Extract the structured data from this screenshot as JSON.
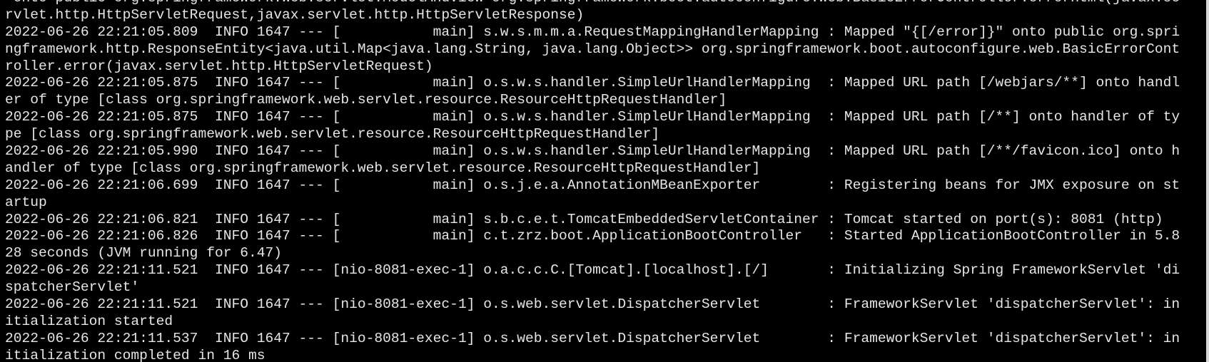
{
  "terminal": {
    "lines": [
      " onto public org.springframework.web.servlet.ModelAndView org.springframework.boot.autoconfigure.web.BasicErrorController.errorHtml(javax.se",
      "rvlet.http.HttpServletRequest,javax.servlet.http.HttpServletResponse)",
      "2022-06-26 22:21:05.809  INFO 1647 --- [           main] s.w.s.m.m.a.RequestMappingHandlerMapping : Mapped \"{[/error]}\" onto public org.spri",
      "ngframework.http.ResponseEntity<java.util.Map<java.lang.String, java.lang.Object>> org.springframework.boot.autoconfigure.web.BasicErrorCont",
      "roller.error(javax.servlet.http.HttpServletRequest)",
      "2022-06-26 22:21:05.875  INFO 1647 --- [           main] o.s.w.s.handler.SimpleUrlHandlerMapping  : Mapped URL path [/webjars/**] onto handl",
      "er of type [class org.springframework.web.servlet.resource.ResourceHttpRequestHandler]",
      "2022-06-26 22:21:05.875  INFO 1647 --- [           main] o.s.w.s.handler.SimpleUrlHandlerMapping  : Mapped URL path [/**] onto handler of ty",
      "pe [class org.springframework.web.servlet.resource.ResourceHttpRequestHandler]",
      "2022-06-26 22:21:05.990  INFO 1647 --- [           main] o.s.w.s.handler.SimpleUrlHandlerMapping  : Mapped URL path [/**/favicon.ico] onto h",
      "andler of type [class org.springframework.web.servlet.resource.ResourceHttpRequestHandler]",
      "2022-06-26 22:21:06.699  INFO 1647 --- [           main] o.s.j.e.a.AnnotationMBeanExporter        : Registering beans for JMX exposure on st",
      "artup",
      "2022-06-26 22:21:06.821  INFO 1647 --- [           main] s.b.c.e.t.TomcatEmbeddedServletContainer : Tomcat started on port(s): 8081 (http)",
      "2022-06-26 22:21:06.826  INFO 1647 --- [           main] c.t.zrz.boot.ApplicationBootController   : Started ApplicationBootController in 5.8",
      "28 seconds (JVM running for 6.47)",
      "2022-06-26 22:21:11.521  INFO 1647 --- [nio-8081-exec-1] o.a.c.c.C.[Tomcat].[localhost].[/]       : Initializing Spring FrameworkServlet 'di",
      "spatcherServlet'",
      "2022-06-26 22:21:11.521  INFO 1647 --- [nio-8081-exec-1] o.s.web.servlet.DispatcherServlet        : FrameworkServlet 'dispatcherServlet': in",
      "itialization started",
      "2022-06-26 22:21:11.537  INFO 1647 --- [nio-8081-exec-1] o.s.web.servlet.DispatcherServlet        : FrameworkServlet 'dispatcherServlet': in",
      "itialization completed in 16 ms"
    ]
  }
}
